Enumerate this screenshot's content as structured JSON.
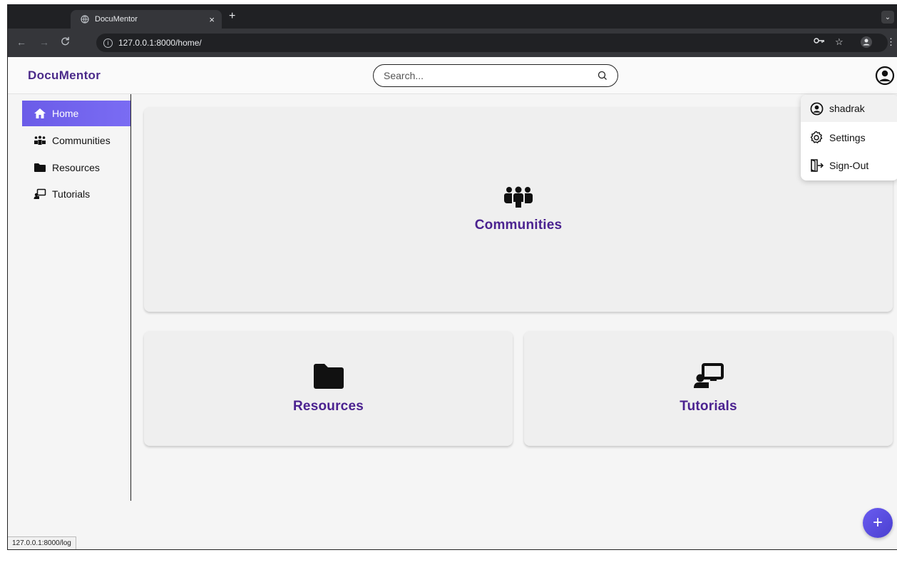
{
  "browser": {
    "tab_title": "DocuMentor",
    "tab_close": "×",
    "new_tab": "+",
    "tab_menu": "⌄",
    "url": "127.0.0.1:8000/home/",
    "status_url": "127.0.0.1:8000/log"
  },
  "header": {
    "brand": "DocuMentor",
    "search_placeholder": "Search..."
  },
  "sidebar": {
    "items": [
      {
        "label": "Home",
        "icon": "home-icon"
      },
      {
        "label": "Communities",
        "icon": "people-icon"
      },
      {
        "label": "Resources",
        "icon": "folder-icon"
      },
      {
        "label": "Tutorials",
        "icon": "presentation-icon"
      }
    ]
  },
  "cards": {
    "communities": "Communities",
    "resources": "Resources",
    "tutorials": "Tutorials"
  },
  "dropdown": {
    "items": [
      {
        "label": "shadrak",
        "icon": "user-circle-icon"
      },
      {
        "label": "Settings",
        "icon": "gear-icon"
      },
      {
        "label": "Sign-Out",
        "icon": "sign-out-icon"
      }
    ]
  },
  "fab": {
    "label": "+"
  },
  "colors": {
    "brand": "#4b2a8a",
    "accent": "#6b5ce8",
    "card_label": "#4b2290"
  }
}
